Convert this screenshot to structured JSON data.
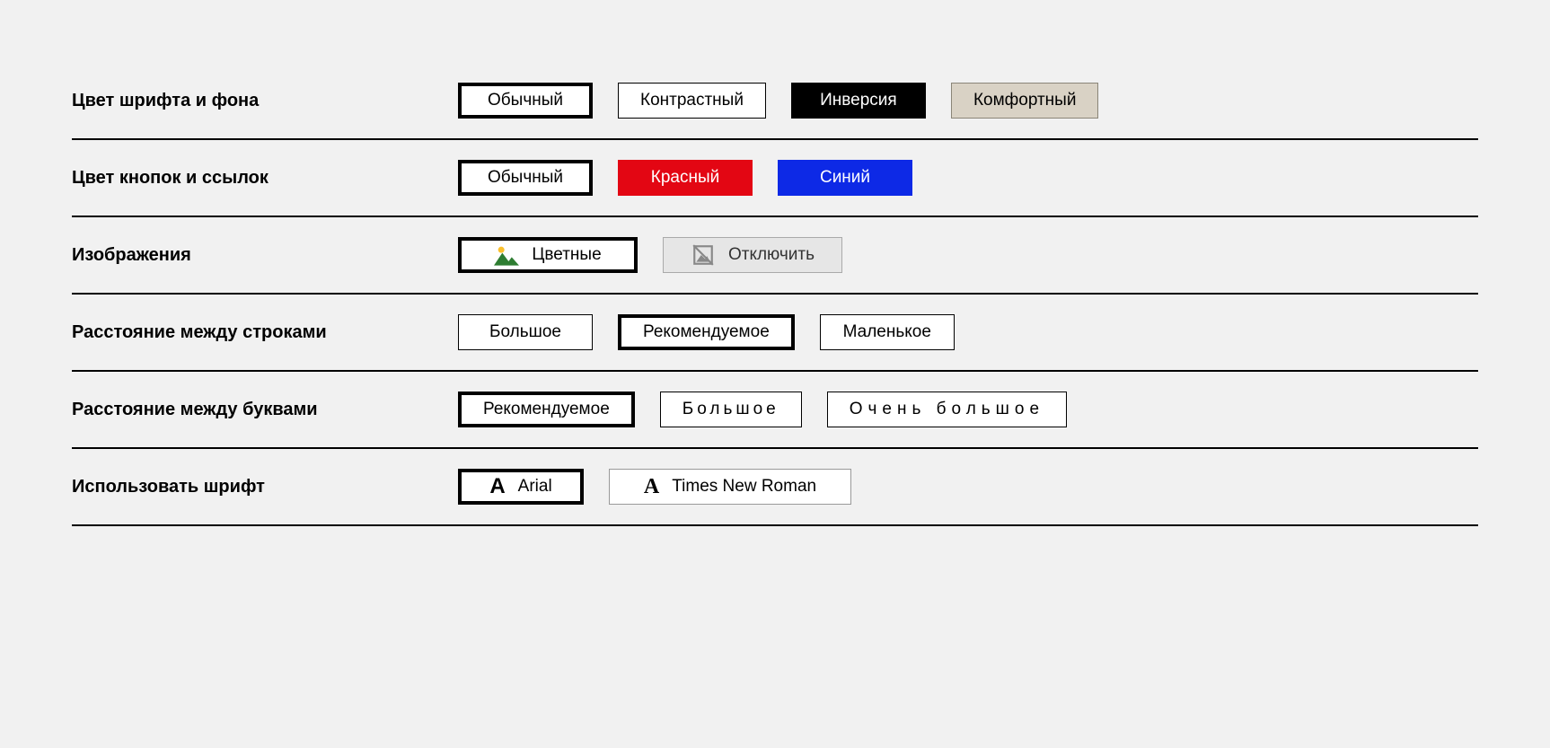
{
  "colorScheme": {
    "label": "Цвет шрифта и фона",
    "options": {
      "normal": "Обычный",
      "contrast": "Контрастный",
      "inversion": "Инверсия",
      "comfort": "Комфортный"
    }
  },
  "buttonLinkColor": {
    "label": "Цвет кнопок и ссылок",
    "options": {
      "normal": "Обычный",
      "red": "Красный",
      "blue": "Синий"
    }
  },
  "images": {
    "label": "Изображения",
    "options": {
      "color": "Цветные",
      "off": "Отключить"
    }
  },
  "lineSpacing": {
    "label": "Расстояние между строками",
    "options": {
      "big": "Большое",
      "recommended": "Рекомендуемое",
      "small": "Маленькое"
    }
  },
  "letterSpacing": {
    "label": "Расстояние между буквами",
    "options": {
      "recommended": "Рекомендуемое",
      "big": "Большое",
      "huge": "Очень большое"
    }
  },
  "font": {
    "label": "Использовать шрифт",
    "glyph": "A",
    "options": {
      "arial": "Arial",
      "times": "Times New Roman"
    }
  }
}
